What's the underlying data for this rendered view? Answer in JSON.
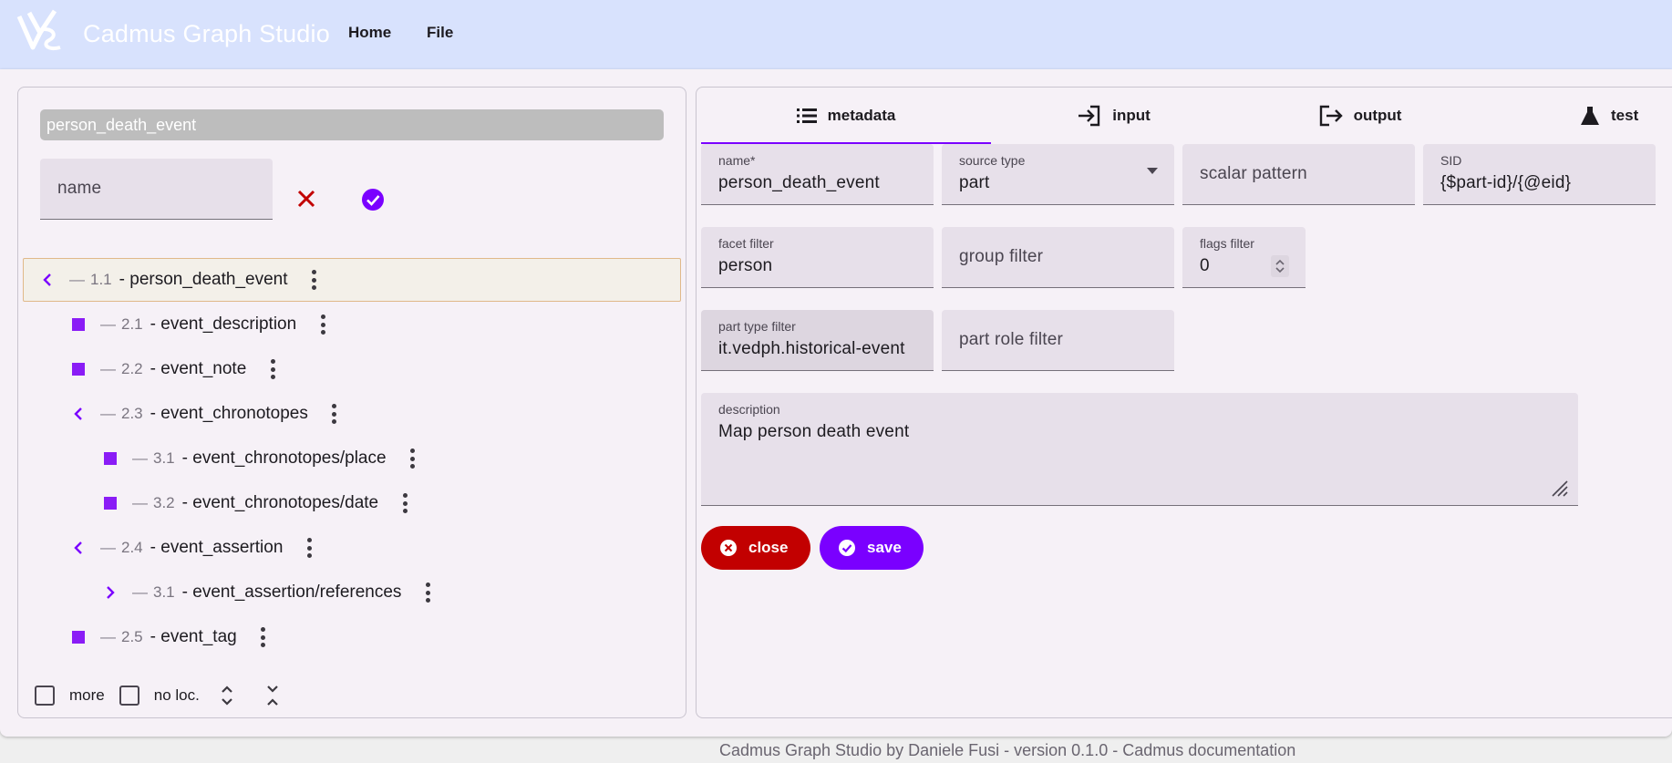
{
  "app": {
    "title": "Cadmus Graph Studio",
    "nav": [
      "Home",
      "File"
    ]
  },
  "left": {
    "selected_chip": "person_death_event",
    "name_placeholder": "name",
    "tree": [
      {
        "number": "1.1",
        "label": "- person_death_event",
        "icon": "chevron-left-icon",
        "selected": true
      },
      {
        "number": "2.1",
        "label": "- event_description",
        "icon": "square-icon"
      },
      {
        "number": "2.2",
        "label": "- event_note",
        "icon": "square-icon"
      },
      {
        "number": "2.3",
        "label": "- event_chronotopes",
        "icon": "chevron-left-icon"
      },
      {
        "number": "3.1",
        "label": "- event_chronotopes/place",
        "icon": "square-icon"
      },
      {
        "number": "3.2",
        "label": "- event_chronotopes/date",
        "icon": "square-icon"
      },
      {
        "number": "2.4",
        "label": "- event_assertion",
        "icon": "chevron-left-icon"
      },
      {
        "number": "3.1",
        "label": "- event_assertion/references",
        "icon": "chevron-right-icon"
      },
      {
        "number": "2.5",
        "label": "- event_tag",
        "icon": "square-icon"
      }
    ],
    "bottom": {
      "more": "more",
      "no_loc": "no loc."
    }
  },
  "tabs": [
    {
      "label": "metadata",
      "icon": "list-icon",
      "active": true
    },
    {
      "label": "input",
      "icon": "login-icon"
    },
    {
      "label": "output",
      "icon": "logout-icon"
    },
    {
      "label": "test",
      "icon": "flask-icon"
    }
  ],
  "form": {
    "name": {
      "label": "name*",
      "value": "person_death_event"
    },
    "source_type": {
      "label": "source type",
      "value": "part"
    },
    "scalar_pattern": {
      "placeholder": "scalar pattern"
    },
    "sid": {
      "label": "SID",
      "value": "{$part-id}/{@eid}"
    },
    "facet_filter": {
      "label": "facet filter",
      "value": "person"
    },
    "group_filter": {
      "placeholder": "group filter"
    },
    "flags_filter": {
      "label": "flags filter",
      "value": "0"
    },
    "part_type_filter": {
      "label": "part type filter",
      "value": "it.vedph.historical-event"
    },
    "part_role_filter": {
      "placeholder": "part role filter"
    },
    "description": {
      "label": "description",
      "value": "Map person death event"
    }
  },
  "buttons": {
    "close": "close",
    "save": "save"
  },
  "footer": "Cadmus Graph Studio by Daniele Fusi - version 0.1.0 - Cadmus documentation",
  "colors": {
    "accent": "#7a00ff",
    "danger": "#c20000",
    "topbar": "#d8e2fd"
  }
}
